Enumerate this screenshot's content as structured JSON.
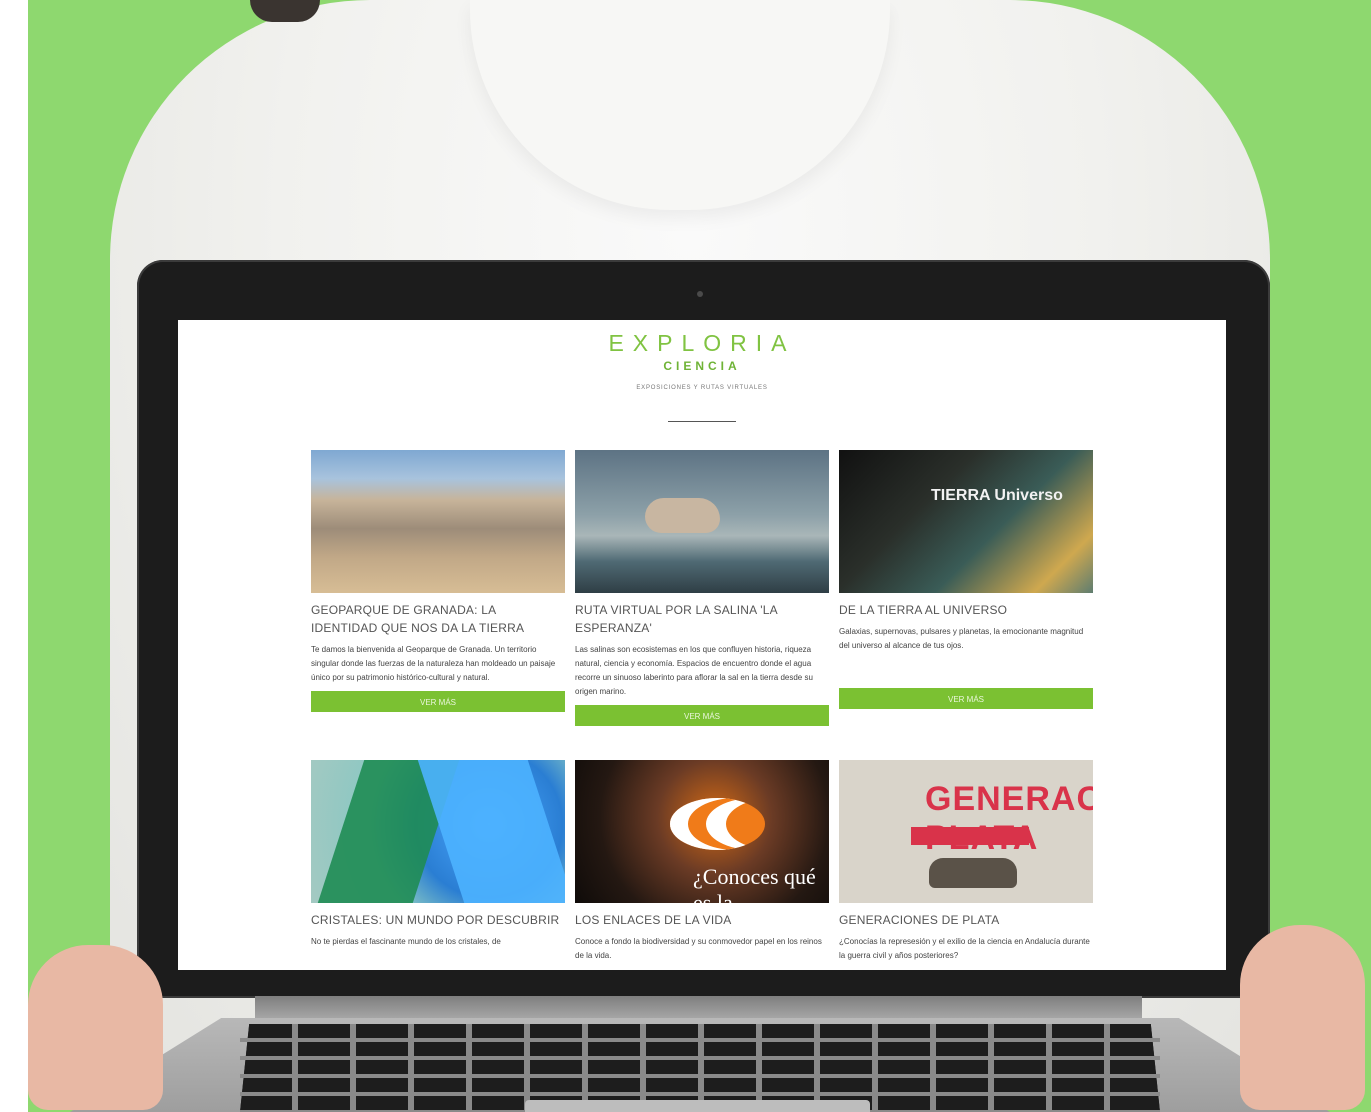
{
  "brand": {
    "name": "EXPLORIA",
    "subtitle": "CIENCIA",
    "tagline": "EXPOSICIONES Y RUTAS VIRTUALES"
  },
  "cards": [
    {
      "title": "GEOPARQUE DE GRANADA: LA IDENTIDAD QUE NOS DA LA TIERRA",
      "text": "Te damos la bienvenida al Geoparque de Granada. Un territorio singular donde las fuerzas de la naturaleza han moldeado un paisaje único por su patrimonio histórico-cultural y natural.",
      "button": "VER MÁS"
    },
    {
      "title": "RUTA VIRTUAL POR LA SALINA 'LA ESPERANZA'",
      "text": "Las salinas son ecosistemas en los que confluyen historia, riqueza natural, ciencia y economía. Espacios de encuentro donde el agua recorre un sinuoso laberinto para aflorar la sal en la tierra desde su origen marino.",
      "button": "VER MÁS"
    },
    {
      "title": "DE LA TIERRA AL UNIVERSO",
      "text": "Galaxias, supernovas, pulsares y planetas, la emocionante magnitud del universo al alcance de tus ojos.",
      "button": "VER MÁS",
      "image_label": "TIERRA Universo"
    },
    {
      "title": "CRISTALES: UN MUNDO POR DESCUBRIR",
      "text": "No te pierdas el fascinante mundo de los cristales, de"
    },
    {
      "title": "LOS ENLACES DE LA VIDA",
      "text": "Conoce a fondo la biodiversidad y su conmovedor papel en los reinos de la vida.",
      "image_label": "¿Conoces qué es la biodiversidad?"
    },
    {
      "title": "GENERACIONES DE PLATA",
      "text": "¿Conocías la represesión y el exilio de la ciencia en Andalucía durante la guerra civil y años posteriores?",
      "image_label": "GENERACIONES PLATA"
    }
  ]
}
